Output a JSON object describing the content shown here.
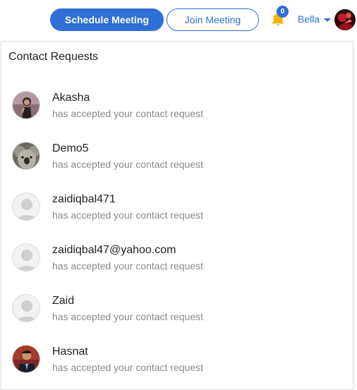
{
  "header": {
    "schedule_label": "Schedule Meeting",
    "join_label": "Join Meeting",
    "notification_count": "0",
    "user_name": "Bella"
  },
  "panel": {
    "title": "Contact Requests",
    "requests": [
      {
        "name": "Akasha",
        "message": "has accepted your contact request",
        "avatar": "photo-person"
      },
      {
        "name": "Demo5",
        "message": "has accepted your contact request",
        "avatar": "photo-koala"
      },
      {
        "name": "zaidiqbal471",
        "message": "has accepted your contact request",
        "avatar": "default-avatar"
      },
      {
        "name": "zaidiqbal47@yahoo.com",
        "message": "has accepted your contact request",
        "avatar": "default-avatar"
      },
      {
        "name": "Zaid",
        "message": "has accepted your contact request",
        "avatar": "default-avatar"
      },
      {
        "name": "Hasnat",
        "message": "has accepted your contact request",
        "avatar": "photo-person-suit"
      }
    ]
  },
  "colors": {
    "accent": "#2f6fd6",
    "bell": "#f5b400",
    "muted_text": "#8a8a8a"
  }
}
